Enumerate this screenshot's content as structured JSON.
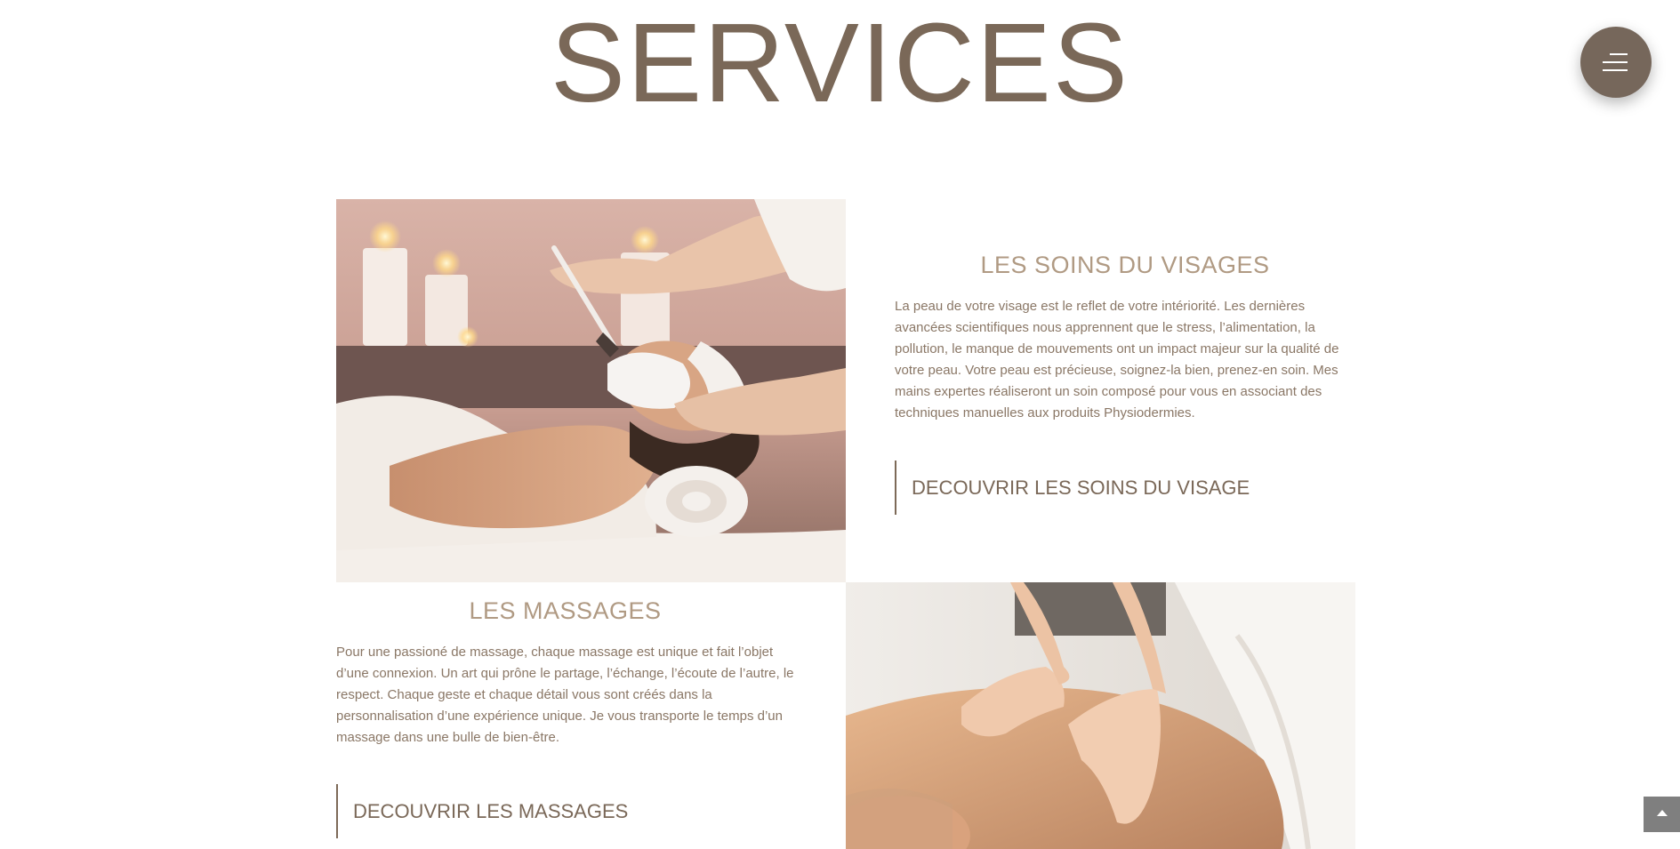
{
  "page": {
    "title": "SERVICES"
  },
  "menu": {
    "icon": "hamburger-menu-icon"
  },
  "sections": [
    {
      "heading": "LES SOINS DU VISAGES",
      "text": "La peau de votre visage est le reflet de votre intériorité. Les dernières avancées scientifiques nous apprennent que le stress, l’alimentation, la pollution, le manque de mouvements ont un impact majeur sur la qualité de votre peau. Votre peau est précieuse, soignez-la bien, prenez-en soin. Mes mains expertes réaliseront un soin composé pour vous en associant des techniques manuelles aux produits Physiodermies.",
      "cta": "DECOUVRIR LES SOINS DU VISAGE",
      "image": "facial-treatment-photo"
    },
    {
      "heading": "LES MASSAGES",
      "text": "Pour une passioné de massage, chaque massage est unique et fait l’objet d’une connexion. Un art qui prône le partage, l’échange, l’écoute de l’autre, le respect. Chaque geste et chaque détail vous sont créés dans la personnalisation d’une expérience unique. Je vous transporte le temps d’un massage dans une bulle de bien-être.",
      "cta": "DECOUVRIR LES MASSAGES",
      "image": "back-massage-photo"
    }
  ],
  "scroll_top": {
    "icon": "arrow-up-icon"
  },
  "colors": {
    "title": "#7a6858",
    "heading": "#b09a83",
    "body_text": "#8a7766",
    "menu_bg": "#76675b",
    "scroll_top_bg": "#7f7f7f"
  }
}
